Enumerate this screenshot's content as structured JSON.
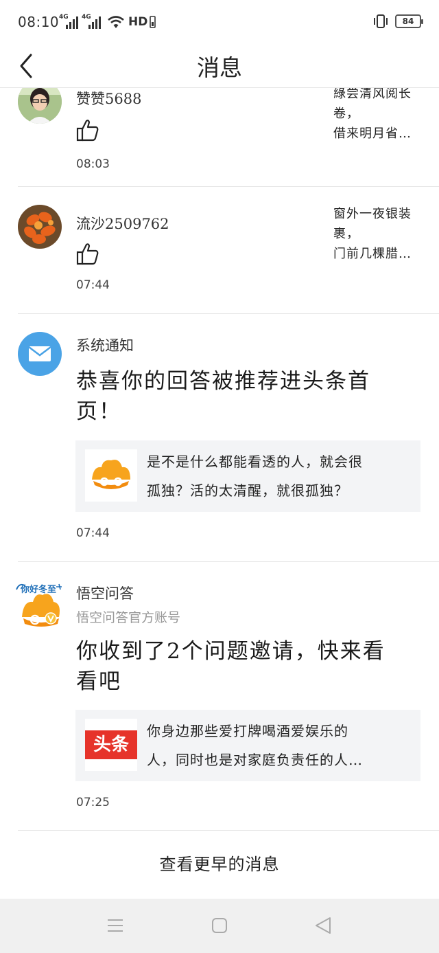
{
  "status_bar": {
    "time": "08:10",
    "network_label": "4G",
    "hd_label": "HD",
    "battery": "84"
  },
  "header": {
    "title": "消息"
  },
  "notifications": [
    {
      "name": "赞赞5688",
      "time": "08:03",
      "quote_lines": [
        "綠尝清风阅长",
        "卷，",
        "借来明月省…"
      ]
    },
    {
      "name": "流沙2509762",
      "time": "07:44",
      "quote_lines": [
        "窗外一夜银装",
        "裹，",
        "门前几棵腊…"
      ]
    }
  ],
  "system_notice": {
    "sender": "系统通知",
    "headline_lines": [
      "恭喜你的回答被推荐进头条首",
      "页！"
    ],
    "card_lines": [
      "是不是什么都能看透的人，就会很",
      "孤独？活的太清醒，就很孤独？"
    ],
    "time": "07:44"
  },
  "wukong_notice": {
    "sender": "悟空问答",
    "subtitle": "悟空问答官方账号",
    "avatar_text": "你好冬至",
    "headline_lines": [
      "你收到了2个问题邀请，快来看",
      "看吧"
    ],
    "card_logo_text": "头条",
    "card_lines": [
      "你身边那些爱打牌喝酒爱娱乐的",
      "人，同时也是对家庭负责任的人…"
    ],
    "time": "07:25"
  },
  "footer": {
    "more_label": "查看更早的消息"
  },
  "colors": {
    "mail_blue": "#4aa3e6",
    "toutiao_red": "#e6332a",
    "card_bg": "#f3f4f6"
  }
}
